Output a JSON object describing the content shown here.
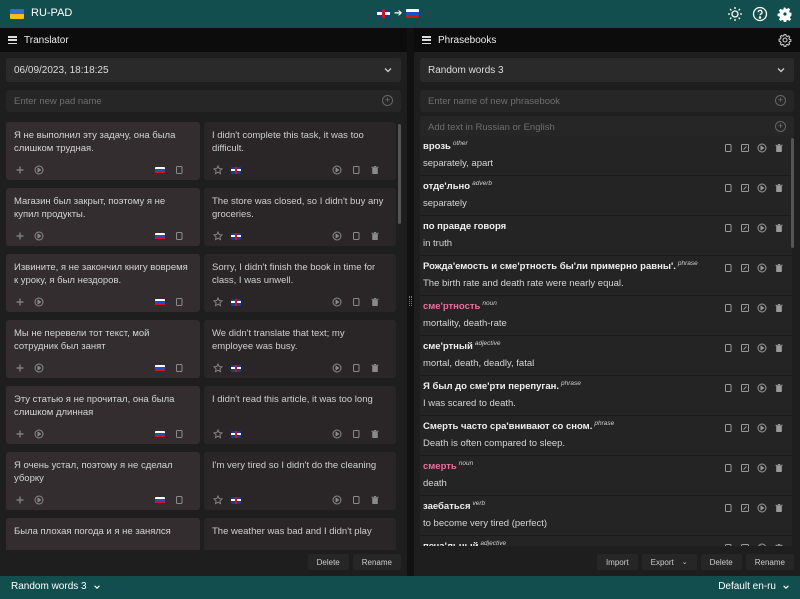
{
  "app": {
    "title": "RU-PAD"
  },
  "top_icons": [
    "brightness-icon",
    "help-icon",
    "settings-icon"
  ],
  "translator": {
    "title": "Translator",
    "pad_selected": "06/09/2023, 18:18:25",
    "new_pad_placeholder": "Enter new pad name",
    "cards": [
      {
        "ru": "Я не выполнил эту задачу, она была слишком трудная.",
        "en": "I didn't complete this task, it was too difficult."
      },
      {
        "ru": "Магазин был закрыт, поэтому я не купил продукты.",
        "en": "The store was closed, so I didn't buy any groceries."
      },
      {
        "ru": "Извините, я не закончил книгу вовремя к уроку, я был нездоров.",
        "en": "Sorry, I didn't finish the book in time for class, I was unwell."
      },
      {
        "ru": "Мы не перевели тот текст, мой сотрудник был занят",
        "en": "We didn't translate that text; my employee was busy."
      },
      {
        "ru": "Эту статью я не прочитал, она была слишком длинная",
        "en": "I didn't read this article, it was too long"
      },
      {
        "ru": "Я очень устал, поэтому я не сделал уборку",
        "en": "I'm very tired so I didn't do the cleaning"
      },
      {
        "ru": "Была плохая погода и я не занялся",
        "en": "The weather was bad and I didn't play"
      }
    ],
    "buttons": {
      "delete": "Delete",
      "rename": "Rename"
    }
  },
  "phrasebooks": {
    "title": "Phrasebooks",
    "selected": "Random words 3",
    "new_placeholder": "Enter name of new phrasebook",
    "add_placeholder": "Add text in Russian or English",
    "items": [
      {
        "word": "врозь",
        "tag": "other",
        "trans": "separately, apart",
        "pink": false
      },
      {
        "word": "отде'льно",
        "tag": "adverb",
        "trans": "separately",
        "pink": false
      },
      {
        "word": "по правде говоря",
        "tag": "",
        "trans": "in truth",
        "pink": false
      },
      {
        "word": "Рожда'емость и сме'ртность бы'ли примерно равны'.",
        "tag": "phrase",
        "trans": "The birth rate and death rate were nearly equal.",
        "pink": false
      },
      {
        "word": "сме'ртность",
        "tag": "noun",
        "trans": "mortality, death-rate",
        "pink": true
      },
      {
        "word": "сме'ртный",
        "tag": "adjective",
        "trans": "mortal, death, deadly, fatal",
        "pink": false
      },
      {
        "word": "Я был до сме'рти перепуган.",
        "tag": "phrase",
        "trans": "I was scared to death.",
        "pink": false
      },
      {
        "word": "Смерть часто сра'внивают со сном.",
        "tag": "phrase",
        "trans": "Death is often compared to sleep.",
        "pink": false
      },
      {
        "word": "смерть",
        "tag": "noun",
        "trans": "death",
        "pink": true
      },
      {
        "word": "заебаться",
        "tag": "verb",
        "trans": "to become very tired (perfect)",
        "pink": false
      },
      {
        "word": "печа'льный",
        "tag": "adjective",
        "trans": "",
        "pink": false
      }
    ],
    "buttons": {
      "import": "Import",
      "export": "Export",
      "delete": "Delete",
      "rename": "Rename"
    }
  },
  "bottombar": {
    "left": "Random words 3",
    "right": "Default en-ru"
  },
  "colors": {
    "accent": "#134e4f",
    "pink": "#e9739d"
  }
}
